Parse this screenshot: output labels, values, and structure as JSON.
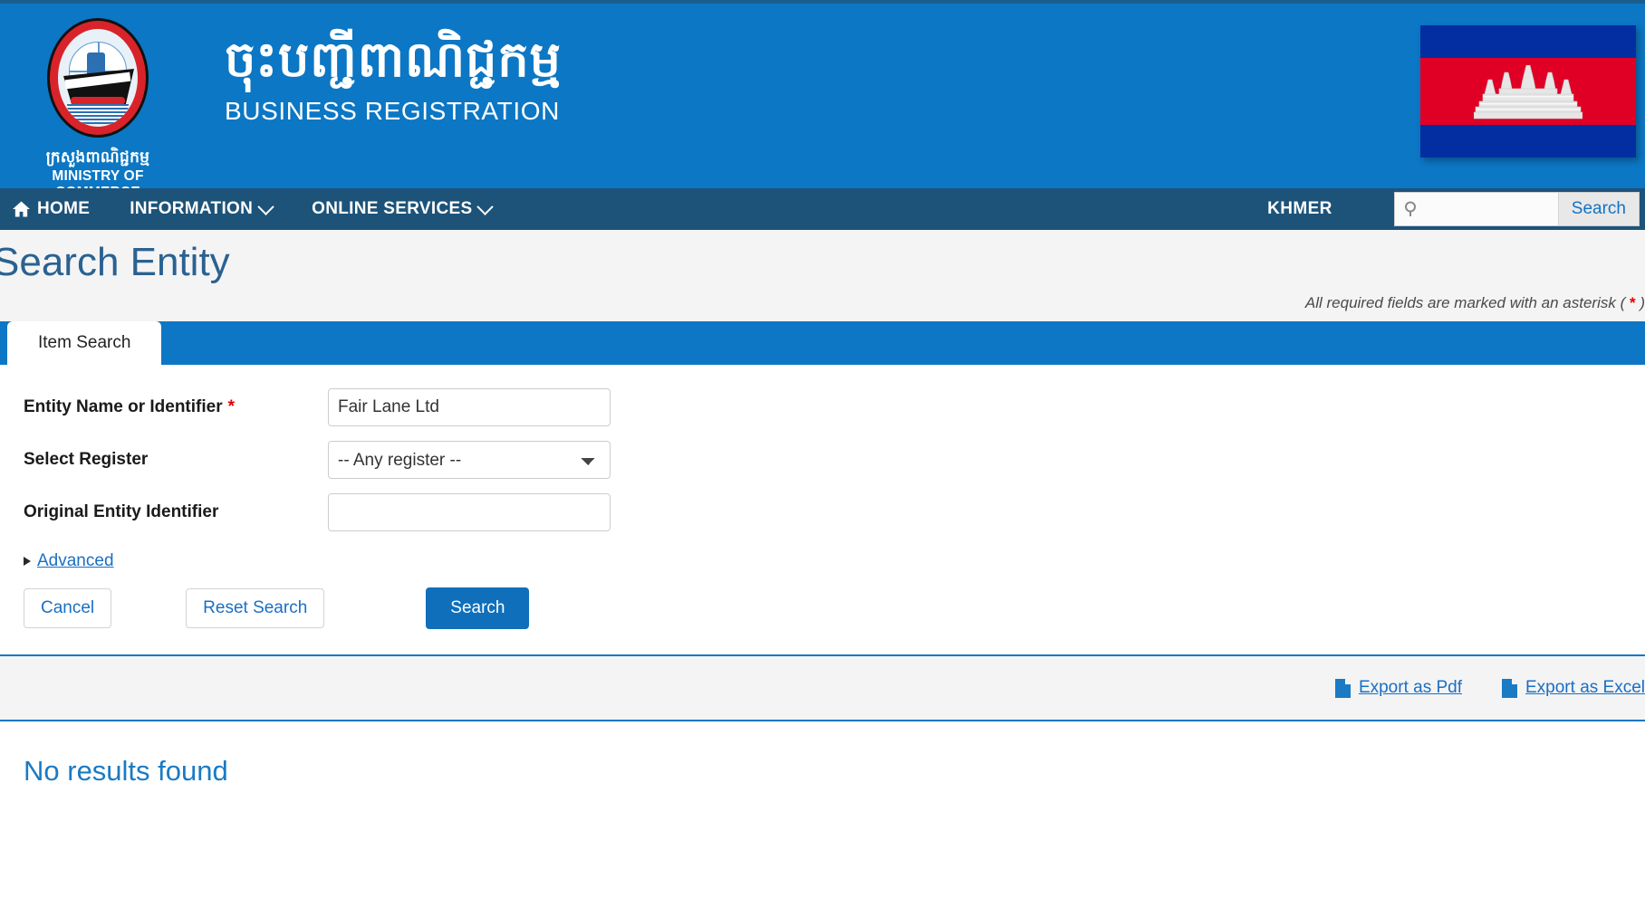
{
  "header": {
    "ministry_kh": "ក្រសួងពាណិជ្ជកម្ម",
    "ministry_en": "MINISTRY OF COMMERCE",
    "title_kh": "ចុះបញ្ជីពាណិជ្ជកម្ម",
    "title_en": "BUSINESS REGISTRATION",
    "flag_alt": "cambodia-flag"
  },
  "nav": {
    "items": [
      {
        "label": "HOME",
        "icon": "home-icon",
        "caret": false
      },
      {
        "label": "INFORMATION",
        "icon": "",
        "caret": true
      },
      {
        "label": "ONLINE SERVICES",
        "icon": "",
        "caret": true
      }
    ],
    "language_label": "KHMER",
    "search_value": "",
    "search_placeholder": "",
    "search_button": "Search",
    "search_icon": "magnifier-icon"
  },
  "page": {
    "title": "Search Entity",
    "required_note_prefix": "All required fields are marked with an asterisk ( ",
    "required_note_star": "*",
    "required_note_suffix": " )"
  },
  "tabs": [
    {
      "label": "Item Search",
      "active": true
    }
  ],
  "form": {
    "fields": [
      {
        "label": "Entity Name or Identifier",
        "required": true,
        "type": "text",
        "value": "Fair Lane Ltd",
        "name": "entity-name-or-identifier-field"
      },
      {
        "label": "Select Register",
        "required": false,
        "type": "select",
        "value": "-- Any register --",
        "name": "select-register-dropdown"
      },
      {
        "label": "Original Entity Identifier",
        "required": false,
        "type": "text",
        "value": "",
        "name": "original-entity-identifier-field"
      }
    ],
    "advanced_label": "Advanced",
    "buttons": {
      "cancel": "Cancel",
      "reset": "Reset Search",
      "search": "Search"
    }
  },
  "results": {
    "export_pdf": "Export as Pdf",
    "export_excel": "Export as Excel",
    "export_icon": "document-icon",
    "message": "No results found"
  },
  "colors": {
    "header_blue": "#0c77c4",
    "nav_blue": "#1d5379",
    "tab_blue": "#0d77c6",
    "link_blue": "#1a6fc4",
    "primary_button": "#0f6fbb",
    "required_red": "#e00000",
    "flag_blue": "#032ea1",
    "flag_red": "#e00025"
  }
}
